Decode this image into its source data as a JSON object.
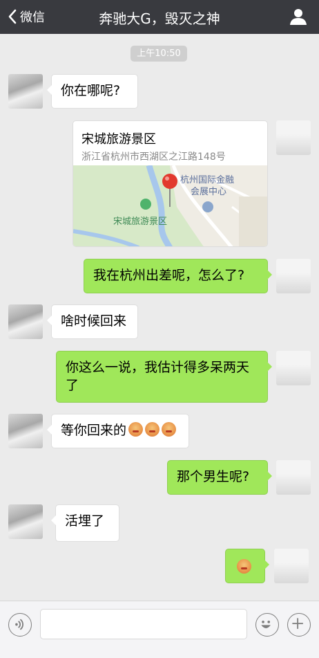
{
  "header": {
    "back_label": "微信",
    "title": "奔驰大G，毁灭之神",
    "profile_icon": "person-icon"
  },
  "timestamp": "上午10:50",
  "messages": [
    {
      "side": "left",
      "text": "你在哪呢?"
    },
    {
      "side": "right",
      "type": "location",
      "place": "宋城旅游景区",
      "address": "浙江省杭州市西湖区之江路148号",
      "map_label_1": "杭州国际金融",
      "map_label_2": "会展中心",
      "map_label_3": "宋城旅游景区"
    },
    {
      "side": "right",
      "text": "我在杭州出差呢，怎么了?"
    },
    {
      "side": "left",
      "text": "啥时候回来"
    },
    {
      "side": "right",
      "text": "你这么一说，我估计得多呆两天了"
    },
    {
      "side": "left",
      "text": "等你回来的",
      "emoji_count": 3
    },
    {
      "side": "right",
      "text": "那个男生呢?"
    },
    {
      "side": "left",
      "text": "活埋了"
    },
    {
      "side": "right",
      "type": "emoji",
      "emoji_count": 1
    }
  ],
  "colors": {
    "navbar": "#393a3f",
    "green_bubble": "#a0e75a",
    "background": "#ebebeb"
  },
  "input_bar": {
    "voice_icon": "voice-icon",
    "emoji_icon": "smiley-icon",
    "plus_icon": "plus-icon",
    "placeholder": ""
  }
}
